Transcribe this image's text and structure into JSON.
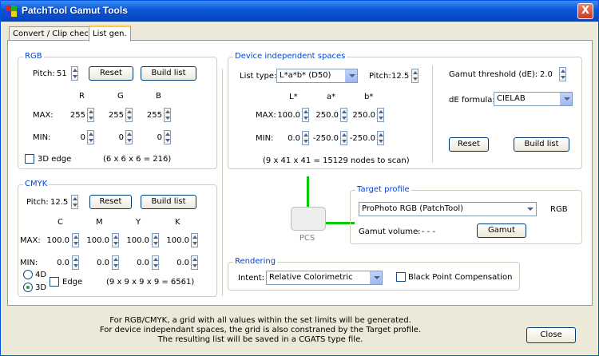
{
  "window": {
    "title": "PatchTool Gamut Tools",
    "close_glyph": "X"
  },
  "tabs": [
    {
      "label": "Convert / Clip check"
    },
    {
      "label": "List gen."
    }
  ],
  "rgb": {
    "title": "RGB",
    "pitch_label": "Pitch:",
    "pitch_value": "51",
    "reset": "Reset",
    "build": "Build list",
    "col_r": "R",
    "col_g": "G",
    "col_b": "B",
    "max_label": "MAX:",
    "min_label": "MIN:",
    "max": [
      "255",
      "255",
      "255"
    ],
    "min": [
      "0",
      "0",
      "0"
    ],
    "edge_label": "3D edge",
    "formula": "(6 x 6 x 6 = 216)"
  },
  "cmyk": {
    "title": "CMYK",
    "pitch_label": "Pitch:",
    "pitch_value": "12.5",
    "reset": "Reset",
    "build": "Build list",
    "cols": [
      "C",
      "M",
      "Y",
      "K"
    ],
    "max_label": "MAX:",
    "min_label": "MIN:",
    "max": [
      "100.0",
      "100.0",
      "100.0",
      "100.0"
    ],
    "min": [
      "0.0",
      "0.0",
      "0.0",
      "0.0"
    ],
    "opt_4d": "4D",
    "opt_3d": "3D",
    "edge_label": "Edge",
    "formula": "(9 x 9 x 9 x 9 = 6561)"
  },
  "dis": {
    "title": "Device independent spaces",
    "list_type_label": "List type:",
    "list_type_value": "L*a*b* (D50)",
    "pitch_label": "Pitch:",
    "pitch_value": "12.5",
    "cols": [
      "L*",
      "a*",
      "b*"
    ],
    "max_label": "MAX:",
    "min_label": "MIN:",
    "max": [
      "100.0",
      "250.0",
      "250.0"
    ],
    "min": [
      "0.0",
      "-250.0",
      "-250.0"
    ],
    "formula": "(9 x 41 x 41 = 15129 nodes to scan)",
    "gamut_threshold_label": "Gamut threshold (dE):",
    "gamut_threshold_value": "2.0",
    "de_formula_label": "dE formula:",
    "de_formula_value": "CIELAB",
    "reset": "Reset",
    "build": "Build list"
  },
  "pcs": {
    "label": "PCS"
  },
  "target": {
    "title": "Target profile",
    "profile_value": "ProPhoto RGB (PatchTool)",
    "space": "RGB",
    "gamut_volume_label": "Gamut volume:",
    "gamut_volume_value": "- - - -",
    "gamut_button": "Gamut"
  },
  "rendering": {
    "title": "Rendering",
    "intent_label": "Intent:",
    "intent_value": "Relative Colorimetric",
    "bpc_label": "Black Point Compensation"
  },
  "footer": {
    "line1": "For RGB/CMYK, a grid with all values within the set limits will be generated.",
    "line2": "For device independant spaces, the grid is also constraned by the Target profile.",
    "line3": "The resulting list will be saved in a CGATS type file.",
    "close": "Close"
  },
  "colors": {
    "titlebar": "#0a58d6",
    "group_title": "#0046d5",
    "connector": "#00cc00",
    "window_bg": "#ece9d8"
  }
}
